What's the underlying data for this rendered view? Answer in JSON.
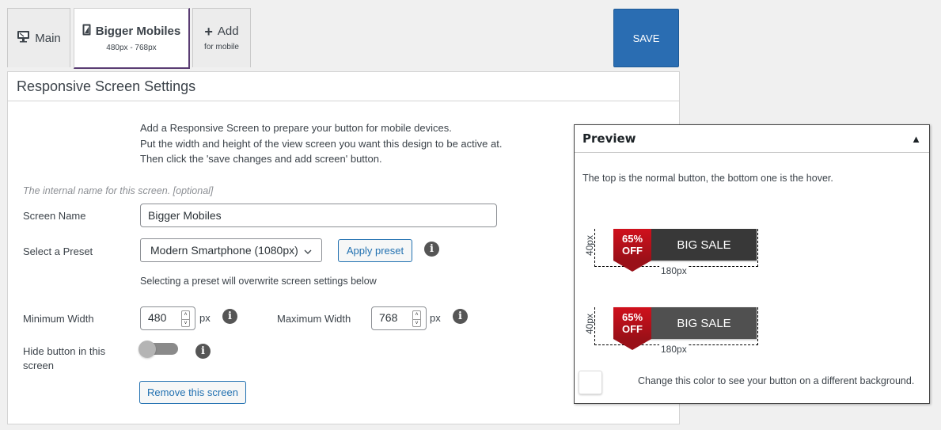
{
  "tabs": [
    {
      "label": "Main",
      "icon": "desktop-icon"
    },
    {
      "label": "Bigger Mobiles",
      "sub": "480px - 768px",
      "icon": "mobile-icon",
      "active": true
    },
    {
      "label": "Add",
      "sub": "for mobile",
      "icon": "plus-icon"
    }
  ],
  "toolbar": {
    "save_label": "SAVE"
  },
  "panel": {
    "title": "Responsive Screen Settings",
    "intro": [
      "Add a Responsive Screen to prepare your button for mobile devices.",
      "Put the width and height of the view screen you want this design to be active at.",
      "Then click the 'save changes and add screen' button."
    ],
    "hint": "The internal name for this screen. [optional]",
    "screen_name": {
      "label": "Screen Name",
      "value": "Bigger Mobiles"
    },
    "preset": {
      "label": "Select a Preset",
      "selected": "Modern Smartphone (1080px)",
      "apply_label": "Apply preset",
      "note": "Selecting a preset will overwrite screen settings below"
    },
    "min_width": {
      "label": "Minimum Width",
      "value": "480",
      "unit": "px"
    },
    "max_width": {
      "label": "Maximum Width",
      "value": "768",
      "unit": "px"
    },
    "hide_button": {
      "label": "Hide button in this screen",
      "checked": false
    },
    "remove_label": "Remove this screen"
  },
  "preview": {
    "title": "Preview",
    "description": "The top is the normal button, the bottom one is the hover.",
    "buttons": [
      {
        "state": "normal",
        "badge_line1": "65%",
        "badge_line2": "OFF",
        "label": "BIG SALE",
        "bg": "#383838",
        "width_label": "180px",
        "height_label": "40px"
      },
      {
        "state": "hover",
        "badge_line1": "65%",
        "badge_line2": "OFF",
        "label": "BIG SALE",
        "bg": "#505050",
        "width_label": "180px",
        "height_label": "40px"
      }
    ],
    "background_note": "Change this color to see your button on a different background.",
    "background_color": "#ffffff"
  },
  "colors": {
    "accent": "#2a6db2",
    "link": "#2271b1",
    "badge_red": "#c8101c",
    "active_tab_border": "#5a3d73"
  }
}
